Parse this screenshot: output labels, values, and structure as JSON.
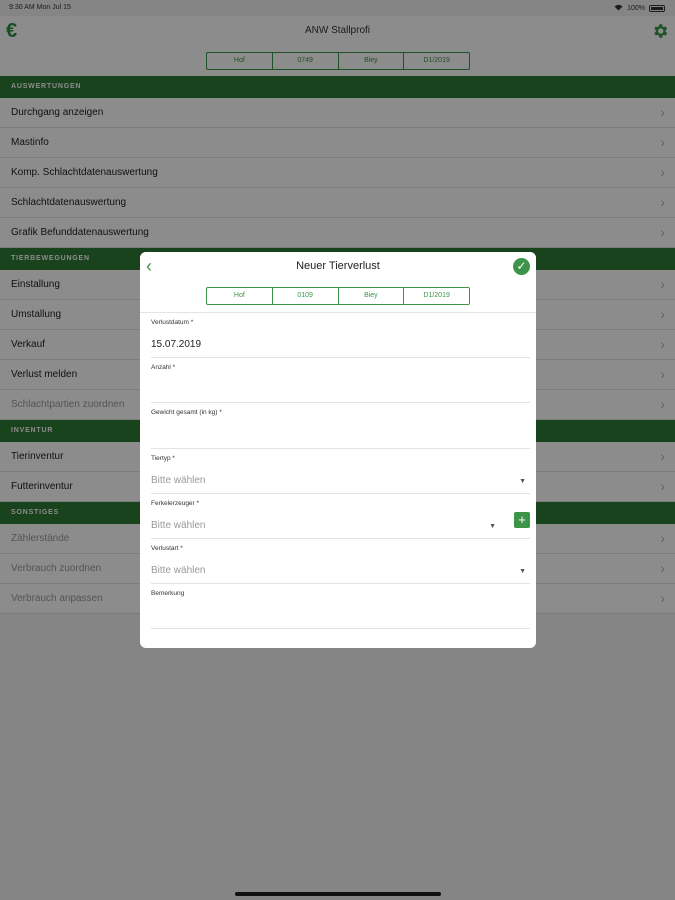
{
  "status_bar": {
    "time": "9:30 AM   Mon Jul 15",
    "battery": "100%"
  },
  "app": {
    "title": "ANW Stallprofi",
    "segments": [
      "Hof",
      "0749",
      "Biey",
      "D1/2019"
    ]
  },
  "sections": [
    {
      "label": "AUSWERTUNGEN",
      "items": [
        {
          "label": "Durchgang anzeigen",
          "enabled": true
        },
        {
          "label": "Mastinfo",
          "enabled": true
        },
        {
          "label": "Komp. Schlachtdatenauswertung",
          "enabled": true
        },
        {
          "label": "Schlachtdatenauswertung",
          "enabled": true
        },
        {
          "label": "Grafik Befunddatenauswertung",
          "enabled": true
        }
      ]
    },
    {
      "label": "TIERBEWEGUNGEN",
      "items": [
        {
          "label": "Einstallung",
          "enabled": true
        },
        {
          "label": "Umstallung",
          "enabled": true
        },
        {
          "label": "Verkauf",
          "enabled": true
        },
        {
          "label": "Verlust melden",
          "enabled": true
        },
        {
          "label": "Schlachtpartien zuordnen",
          "enabled": false
        }
      ]
    },
    {
      "label": "INVENTUR",
      "items": [
        {
          "label": "Tierinventur",
          "enabled": true
        },
        {
          "label": "Futterinventur",
          "enabled": true
        }
      ]
    },
    {
      "label": "SONSTIGES",
      "items": [
        {
          "label": "Zählerstände",
          "enabled": false
        },
        {
          "label": "Verbrauch zuordnen",
          "enabled": false
        },
        {
          "label": "Verbrauch anpassen",
          "enabled": false
        }
      ]
    }
  ],
  "modal": {
    "title": "Neuer Tierverlust",
    "segments": [
      "Hof",
      "0109",
      "Biey",
      "D1/2019"
    ],
    "fields": {
      "verlustdatum": {
        "label": "Verlustdatum *",
        "value": "15.07.2019"
      },
      "anzahl": {
        "label": "Anzahl *",
        "value": ""
      },
      "gewicht": {
        "label": "Gewicht gesamt (in kg) *",
        "value": ""
      },
      "tiertyp": {
        "label": "Tiertyp *",
        "placeholder": "Bitte wählen"
      },
      "ferkelerzeuger": {
        "label": "Ferkelerzeuger *",
        "placeholder": "Bitte wählen"
      },
      "verlustart": {
        "label": "Verlustart *",
        "placeholder": "Bitte wählen"
      },
      "bemerkung": {
        "label": "Bemerkung",
        "value": ""
      }
    }
  },
  "colors": {
    "accent": "#3d9448",
    "section_bg": "#2d7a33"
  },
  "icons": {
    "currency": "euro-icon",
    "settings": "gear-icon",
    "back": "chevron-left-icon",
    "confirm": "check-circle-icon",
    "add": "plus-icon"
  }
}
